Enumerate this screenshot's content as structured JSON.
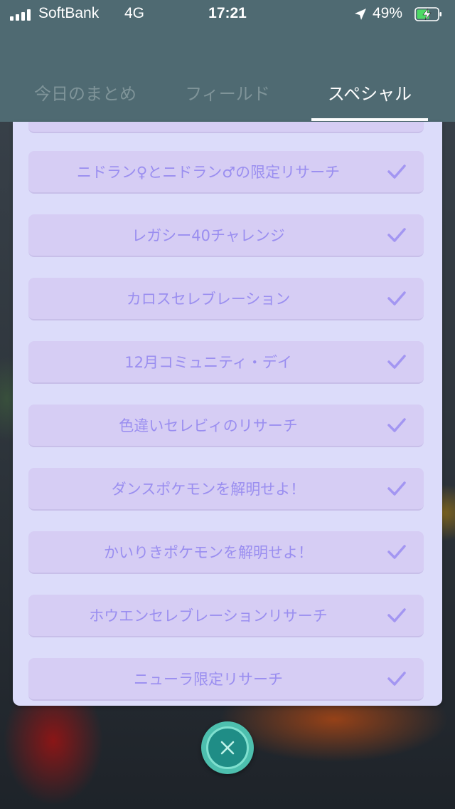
{
  "status_bar": {
    "carrier": "SoftBank",
    "network": "4G",
    "time": "17:21",
    "battery_percent": "49%",
    "icons": [
      "signal-icon",
      "location-arrow-icon",
      "battery-charging-icon"
    ]
  },
  "tabs": [
    {
      "label": "今日のまとめ",
      "active": false
    },
    {
      "label": "フィールド",
      "active": false
    },
    {
      "label": "スペシャル",
      "active": true
    }
  ],
  "research_list": {
    "items": [
      {
        "label": "ニドラン♀とニドラン♂の限定リサーチ",
        "completed": true
      },
      {
        "label": "レガシー40チャレンジ",
        "completed": true
      },
      {
        "label": "カロスセレブレーション",
        "completed": true
      },
      {
        "label": "12月コミュニティ・デイ",
        "completed": true
      },
      {
        "label": "色違いセレビィのリサーチ",
        "completed": true
      },
      {
        "label": "ダンスポケモンを解明せよ！",
        "completed": true
      },
      {
        "label": "かいりきポケモンを解明せよ！",
        "completed": true
      },
      {
        "label": "ホウエンセレブレーションリサーチ",
        "completed": true
      },
      {
        "label": "ニューラ限定リサーチ",
        "completed": true
      }
    ]
  },
  "colors": {
    "header_bg": "#4f6a72",
    "panel_bg": "#dcdcfa",
    "item_bg": "#d6cdf4",
    "item_text": "#9a8ef0",
    "close_button": "#1f8d86"
  },
  "close_button": {
    "icon": "close-icon"
  }
}
